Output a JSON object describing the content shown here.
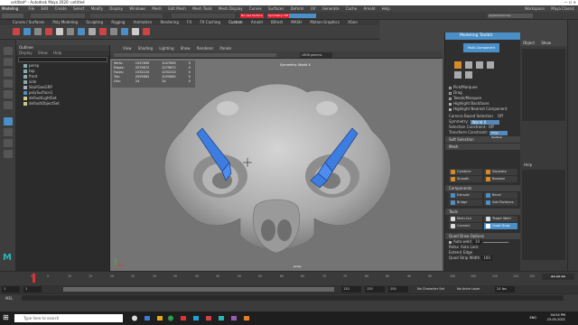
{
  "window": {
    "title": "untitled* - Autodesk Maya 2020: untitled",
    "controls": "—  ☐  ✕"
  },
  "menubar": {
    "items": [
      "File",
      "Edit",
      "Create",
      "Select",
      "Modify",
      "Display",
      "Windows",
      "Mesh",
      "Edit Mesh",
      "Mesh Tools",
      "Mesh Display",
      "Curves",
      "Surfaces",
      "Deform",
      "UV",
      "Generate",
      "Cache",
      "Arnold",
      "Help"
    ],
    "mode": "Modeling",
    "workspace_label": "Workspace:",
    "workspace": "Maya Classic"
  },
  "status": {
    "objects_field": "No Live Surface",
    "symmetry_field": "Symmetry: Off",
    "user_field": "jagdeeshnhno@..."
  },
  "shelf_tabs": [
    "Curves / Surfaces",
    "Poly Modeling",
    "Sculpting",
    "Rigging",
    "Animation",
    "Rendering",
    "FX",
    "FX Caching",
    "Custom",
    "Arnold",
    "Bifrost",
    "MASH",
    "Motion Graphics",
    "XGen"
  ],
  "outliner": {
    "title": "Outliner",
    "menu": [
      "Display",
      "Show",
      "Help"
    ],
    "items": [
      "persp",
      "top",
      "front",
      "side",
      "SkullGeoGRP",
      "polySurface1",
      "defaultLightSet",
      "defaultObjectSet"
    ]
  },
  "viewport": {
    "menu": [
      "View",
      "Shading",
      "Lighting",
      "Show",
      "Renderer",
      "Panels"
    ],
    "stats": [
      {
        "label": "Verts:",
        "a": "1047690",
        "b": "1047690",
        "c": "0"
      },
      {
        "label": "Edges:",
        "a": "2079872",
        "b": "2079872",
        "c": "0"
      },
      {
        "label": "Faces:",
        "a": "1032220",
        "b": "1032220",
        "c": "0"
      },
      {
        "label": "Tris:",
        "a": "2055662",
        "b": "2055662",
        "c": "0"
      },
      {
        "label": "UVs:",
        "a": "24",
        "b": "24",
        "c": "0"
      }
    ],
    "symmetry": "Symmetry: World X",
    "colorspace": "sRGB gamma",
    "camera": "persp"
  },
  "modeling_toolkit": {
    "title": "Modeling Toolkit",
    "multi_component": "Multi-Component",
    "options": [
      "Pick/Marquee",
      "Drag",
      "Tweak/Marquee",
      "Highlight Backfaces",
      "Highlight Nearest Component"
    ],
    "camera_based": "Camera Based Selection",
    "camera_based_val": "Off",
    "symmetry_label": "Symmetry:",
    "symmetry_val": "World X",
    "sel_constraint_label": "Selection Constraint:",
    "sel_constraint_val": "Off",
    "transform_constraint_label": "Transform Constraint:",
    "transform_constraint_val": "Edge Surface",
    "soft_selection": "Soft Selection",
    "mesh_header": "Mesh",
    "mesh_buttons": [
      "Combine",
      "Separate",
      "Smooth",
      "Boolean"
    ],
    "components_header": "Components",
    "component_buttons": [
      "Extrude",
      "Bevel",
      "Bridge",
      "Add Divisions"
    ],
    "tools_header": "Tools",
    "tool_buttons": [
      "Multi-Cut",
      "Target Weld",
      "Connect",
      "Quad Draw"
    ],
    "quad_draw_header": "Quad Draw Options",
    "auto_weld": "Auto weld",
    "auto_weld_val": "10",
    "relax": "Relax",
    "relax_val": "Auto Lock",
    "extend": "Extend",
    "extend_val": "Edge",
    "quad_strip_width": "Quad Strip Width",
    "quad_strip_val": "100"
  },
  "right_panel": {
    "menu": [
      "Object",
      "Show"
    ],
    "help_label": "Help"
  },
  "timeslider": {
    "ticks": [
      "1",
      "5",
      "10",
      "15",
      "20",
      "25",
      "30",
      "35",
      "40",
      "45",
      "50",
      "55",
      "60",
      "65",
      "70",
      "75",
      "80",
      "85",
      "90",
      "95",
      "100",
      "105",
      "110",
      "115",
      "120"
    ],
    "current": "1"
  },
  "range": {
    "start": "1",
    "start2": "1",
    "end_inner": "120",
    "end_a": "120",
    "end_b": "200",
    "fps": "24 fps",
    "character_set": "No Character Set",
    "anim_layer": "No Anim Layer"
  },
  "mel": {
    "label": "MEL"
  },
  "taskbar": {
    "search": "Type here to search",
    "time": "04:54 PM",
    "date": "23-05-2021",
    "lang": "ENG"
  },
  "colors": {
    "accent": "#4a8fc7",
    "face_select": "#3d7de0",
    "mesh_orange": "#d68a28"
  }
}
